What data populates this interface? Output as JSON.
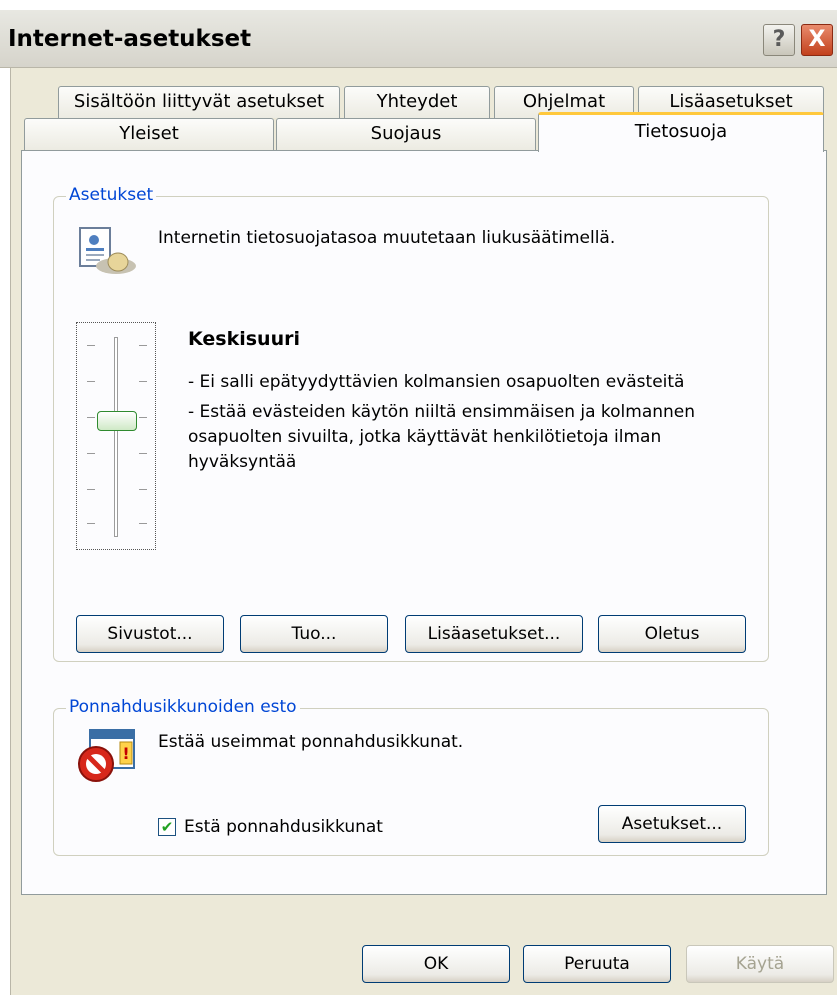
{
  "window": {
    "title": "Internet-asetukset",
    "help_label": "?",
    "close_label": "X"
  },
  "tabs": {
    "row1": [
      "Sisältöön liittyvät asetukset",
      "Yhteydet",
      "Ohjelmat",
      "Lisäasetukset"
    ],
    "row2": [
      "Yleiset",
      "Suojaus",
      "Tietosuoja"
    ],
    "active": "Tietosuoja"
  },
  "settings_group": {
    "title": "Asetukset",
    "description": "Internetin tietosuojatasoa muutetaan liukusäätimellä.",
    "level_title": "Keskisuuri",
    "level_line1": "- Ei salli epätyydyttävien kolmansien osapuolten evästeitä",
    "level_line2": "- Estää evästeiden käytön niiltä ensimmäisen ja kolmannen",
    "level_line3": "osapuolten sivuilta, jotka käyttävät henkilötietoja ilman",
    "level_line4": "hyväksyntää",
    "slider_level_fraction": 0.5,
    "buttons": {
      "sites": "Sivustot...",
      "import": "Tuo...",
      "advanced": "Lisäasetukset...",
      "default": "Oletus"
    }
  },
  "popup_group": {
    "title": "Ponnahdusikkunoiden esto",
    "description": "Estää useimmat ponnahdusikkunat.",
    "checkbox_label": "Estä ponnahdusikkunat",
    "checkbox_checked": true,
    "settings_button": "Asetukset..."
  },
  "footer": {
    "ok": "OK",
    "cancel": "Peruuta",
    "apply": "Käytä"
  },
  "colors": {
    "window_bg": "#ece9d8",
    "group_title": "#0046d5",
    "active_tab_accent": "#ffc83c",
    "close_button": "#c2411d"
  }
}
